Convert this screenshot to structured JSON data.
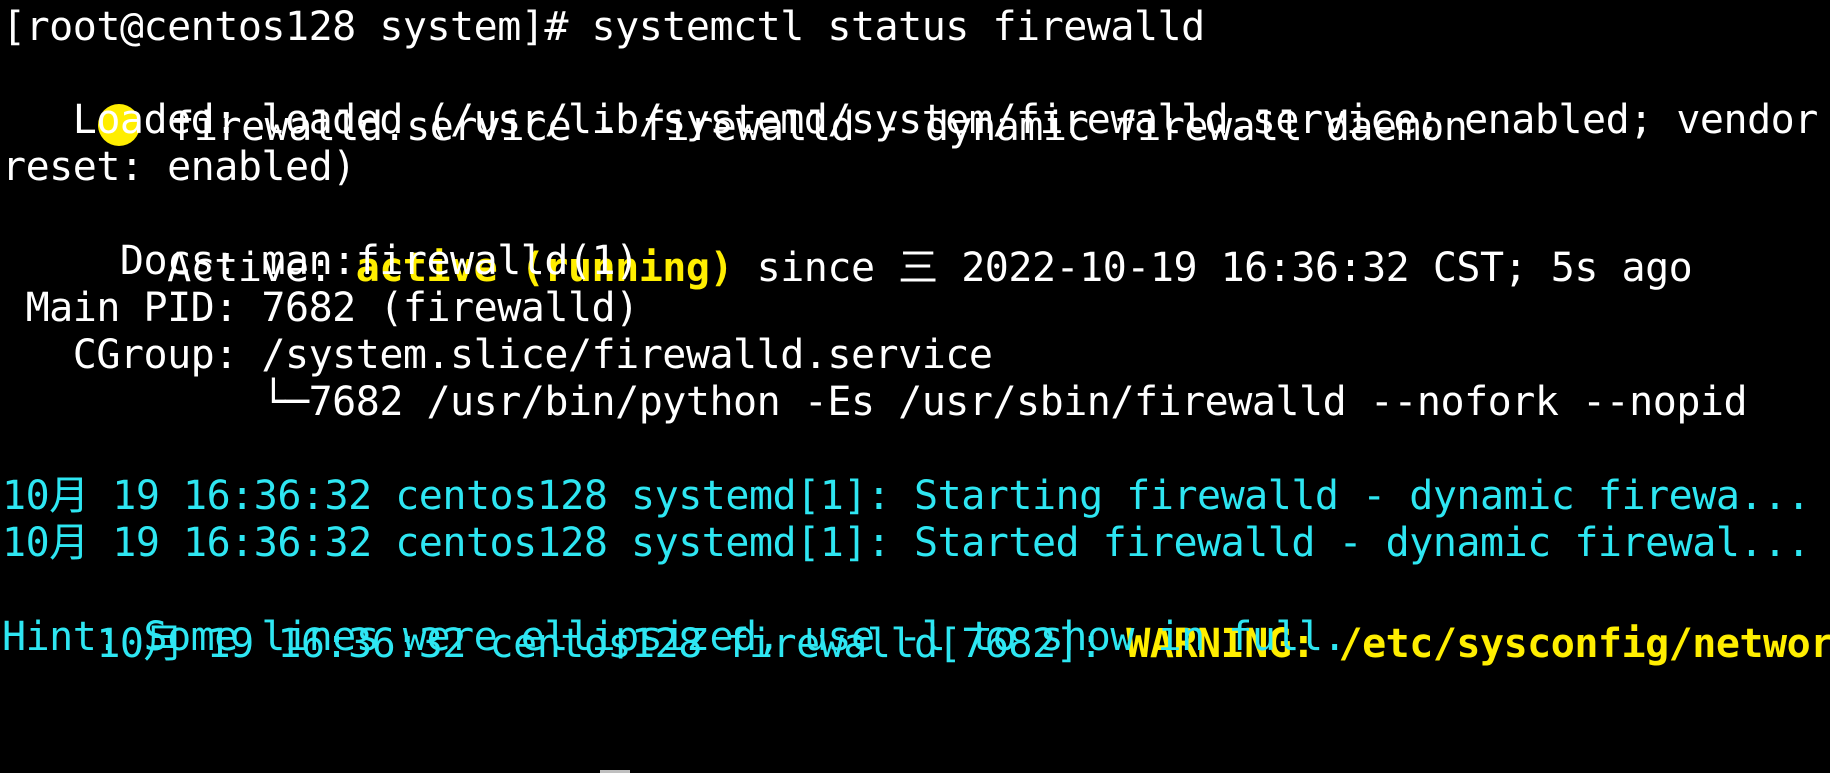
{
  "terminal": {
    "prompt": "[root@centos128 system]# systemctl status firewalld",
    "service_header": "firewalld.service - firewalld - dynamic firewall daemon",
    "status_dot_icon": "filled-circle-icon",
    "loaded_line_1": "   Loaded: loaded (/usr/lib/systemd/system/firewalld.service; enabled; vendor p",
    "loaded_line_2": "reset: enabled)",
    "active_label": "   Active: ",
    "active_state": "active (running)",
    "active_since": " since 三 2022-10-19 16:36:32 CST; 5s ago",
    "docs_line": "     Docs: man:firewalld(1)",
    "mainpid_line": " Main PID: 7682 (firewalld)",
    "cgroup_line": "   CGroup: /system.slice/firewalld.service",
    "cgroup_child": "           └─7682 /usr/bin/python -Es /usr/sbin/firewalld --nofork --nopid",
    "log_1": "10月 19 16:36:32 centos128 systemd[1]: Starting firewalld - dynamic firewa...",
    "log_2": "10月 19 16:36:32 centos128 systemd[1]: Started firewalld - dynamic firewal...",
    "log_3_prefix": "10月 19 16:36:32 centos128 firewalld[7682]: ",
    "log_3_warning": "WARNING: /etc/sysconfig/networ…",
    "hint": "Hint: Some lines were ellipsized, use -l to show in full."
  },
  "colors": {
    "background": "#000000",
    "text_default": "#ffffff",
    "text_cyan": "#2ee6f2",
    "text_yellow": "#ffee00"
  }
}
